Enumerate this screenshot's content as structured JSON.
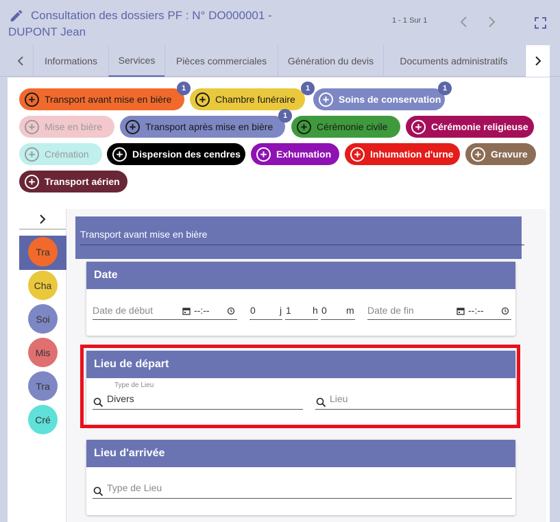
{
  "header": {
    "title_line1": "Consultation des dossiers PF : N° DO000001 -",
    "title_line2": "DUPONT Jean",
    "pager": "1 - 1 Sur 1"
  },
  "tabs": [
    {
      "label": "Informations"
    },
    {
      "label": "Services"
    },
    {
      "label": "Pièces commerciales"
    },
    {
      "label": "Génération du devis"
    },
    {
      "label": "Documents administratifs"
    }
  ],
  "services": [
    {
      "label": "Transport avant mise en bière",
      "badge": "1",
      "bg": "#f16a2c",
      "fg": "#1a1a1a"
    },
    {
      "label": "Chambre funéraire",
      "badge": "1",
      "bg": "#eac83b",
      "fg": "#1a1a1a"
    },
    {
      "label": "Soins de conservation",
      "badge": "1",
      "bg": "#7d87c3",
      "fg": "#ffffff"
    },
    {
      "label": "Mise en bière",
      "badge": "",
      "bg": "#f2c8cc",
      "fg": "#9a9a9a"
    },
    {
      "label": "Transport après mise en bière",
      "badge": "1",
      "bg": "#7d87c3",
      "fg": "#1a1a1a"
    },
    {
      "label": "Cérémonie civile",
      "badge": "",
      "bg": "#3e9a3c",
      "fg": "#1a1a1a"
    },
    {
      "label": "Cérémonie religieuse",
      "badge": "",
      "bg": "#a50f5a",
      "fg": "#ffffff"
    },
    {
      "label": "Crémation",
      "badge": "",
      "bg": "#bff0ed",
      "fg": "#9a9a9a"
    },
    {
      "label": "Dispersion des cendres",
      "badge": "",
      "bg": "#000000",
      "fg": "#ffffff"
    },
    {
      "label": "Exhumation",
      "badge": "",
      "bg": "#8f11b3",
      "fg": "#ffffff"
    },
    {
      "label": "Inhumation d'urne",
      "badge": "",
      "bg": "#e41c1a",
      "fg": "#ffffff"
    },
    {
      "label": "Gravure",
      "badge": "",
      "bg": "#8c6d55",
      "fg": "#ffffff"
    },
    {
      "label": "Transport aérien",
      "badge": "",
      "bg": "#6a2635",
      "fg": "#ffffff"
    }
  ],
  "sidebar": [
    {
      "label": "Tra",
      "color": "#f16a2c"
    },
    {
      "label": "Cha",
      "color": "#eac83b"
    },
    {
      "label": "Soi",
      "color": "#7d87c3"
    },
    {
      "label": "Mis",
      "color": "#e07070"
    },
    {
      "label": "Tra",
      "color": "#7d87c3"
    },
    {
      "label": "Cré",
      "color": "#5fe0d8"
    }
  ],
  "detail": {
    "title": "Transport avant mise en bière",
    "date": {
      "heading": "Date",
      "start_placeholder": "Date de début",
      "start_time": "--:--",
      "days": "0",
      "days_unit": "j",
      "hours": "1",
      "hours_unit": "h",
      "minutes": "0",
      "minutes_unit": "m",
      "end_placeholder": "Date de fin",
      "end_time": "--:--"
    },
    "departure": {
      "heading": "Lieu de départ",
      "type_label": "Type de Lieu",
      "type_value": "Divers",
      "place_placeholder": "Lieu"
    },
    "arrival": {
      "heading": "Lieu d'arrivée",
      "type_placeholder": "Type de Lieu"
    }
  }
}
